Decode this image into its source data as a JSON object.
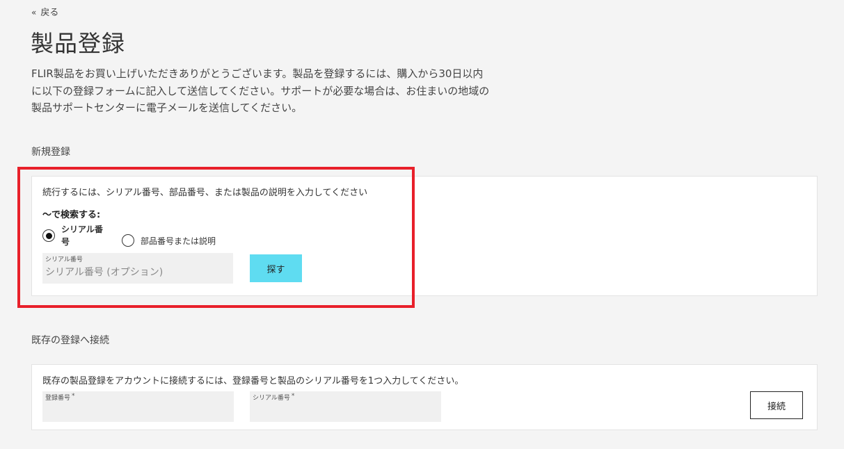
{
  "nav": {
    "back_icon": "double-chevron-left-icon",
    "back_label": "戻る"
  },
  "page_title": "製品登録",
  "intro_text": "FLIR製品をお買い上げいただきありがとうございます。製品を登録するには、購入から30日以内に以下の登録フォームに記入して送信してください。サポートが必要な場合は、お住まいの地域の製品サポートセンターに電子メールを送信してください。",
  "new_registration": {
    "section_label": "新規登録",
    "instruction": "続行するには、シリアル番号、部品番号、または製品の説明を入力してください",
    "search_by_label": "〜で検索する:",
    "options": [
      {
        "label": "シリアル番号",
        "selected": true
      },
      {
        "label": "部品番号または説明",
        "selected": false
      }
    ],
    "serial_field": {
      "label": "シリアル番号",
      "value": "",
      "placeholder": "シリアル番号 (オプション)"
    },
    "search_button": "探す"
  },
  "existing_registration": {
    "section_label": "既存の登録へ接続",
    "instruction": "既存の製品登録をアカウントに接続するには、登録番号と製品のシリアル番号を1つ入力してください。",
    "registration_field": {
      "label": "登録番号",
      "required_mark": "*",
      "value": ""
    },
    "serial_field": {
      "label": "シリアル番号",
      "required_mark": "*",
      "value": ""
    },
    "connect_button": "接続"
  },
  "colors": {
    "search_button": "#5fdcf1",
    "highlight_border": "#e8202a",
    "page_background": "#f4f4f4"
  }
}
